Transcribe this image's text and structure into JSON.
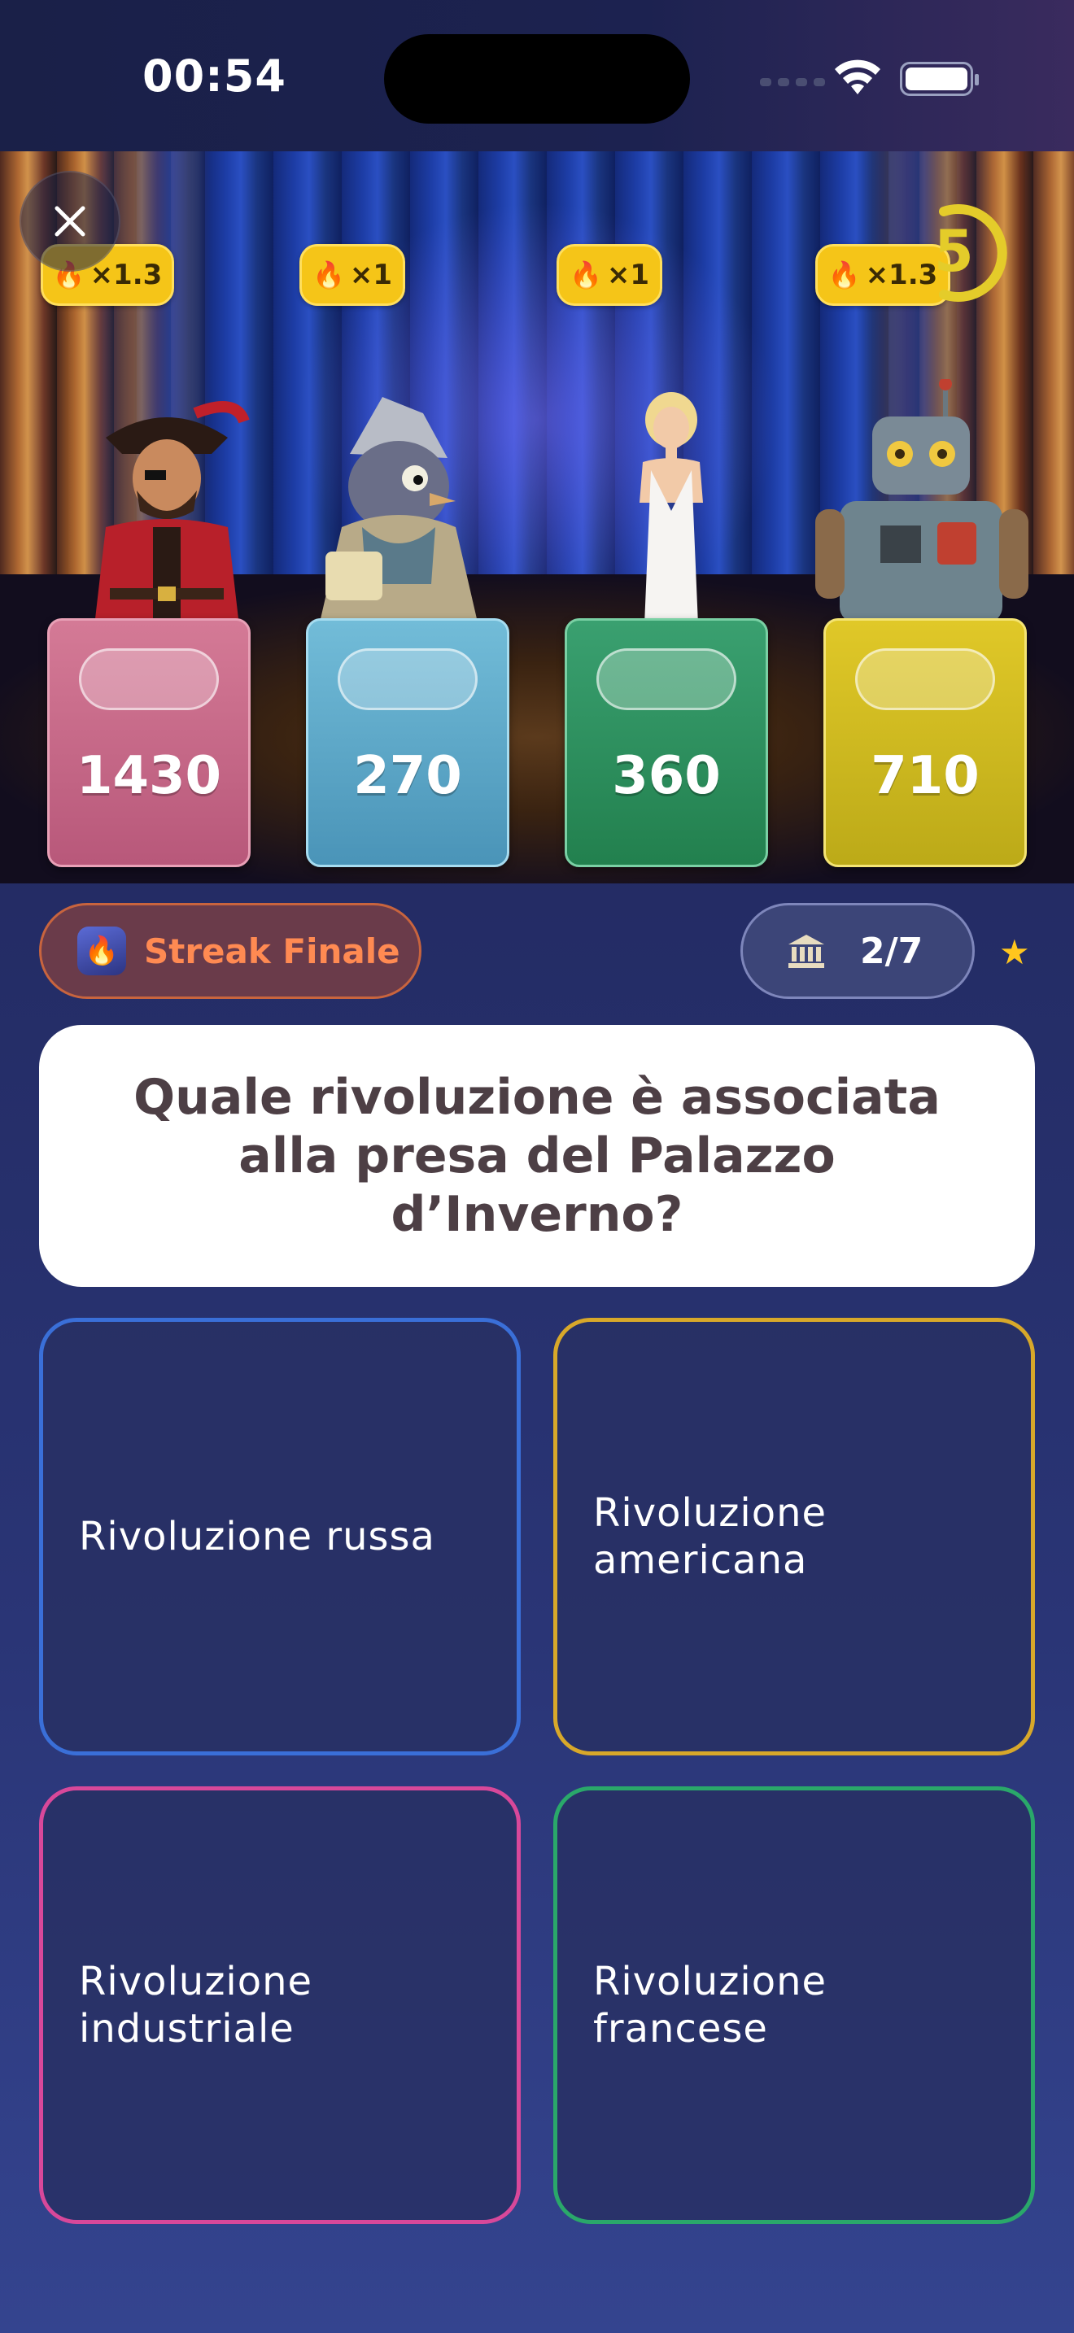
{
  "status_bar": {
    "time": "00:54"
  },
  "game": {
    "timer_value": "5",
    "timer_fraction_remaining": 0.75,
    "multipliers": [
      "×1.3",
      "×1",
      "×1",
      "×1.3"
    ],
    "players": [
      {
        "character": "pirate",
        "score": "1430",
        "color": "#c8607e"
      },
      {
        "character": "pigeon",
        "score": "270",
        "color": "#5aa8c8"
      },
      {
        "character": "diva",
        "score": "360",
        "color": "#2f8f5c"
      },
      {
        "character": "robot",
        "score": "710",
        "color": "#d8c022"
      }
    ]
  },
  "streak": {
    "label": "Streak Finale"
  },
  "progress": {
    "value": "2/7",
    "category_icon": "temple-icon"
  },
  "question": {
    "text": "Quale rivoluzione è associata alla presa del Palazzo d’Inverno?"
  },
  "answers": [
    {
      "label": "Rivoluzione russa",
      "color": "#3a6fd8"
    },
    {
      "label": "Rivoluzione americana",
      "color": "#d8a82a"
    },
    {
      "label": "Rivoluzione industriale",
      "color": "#d8489a"
    },
    {
      "label": "Rivoluzione francese",
      "color": "#2aa86a"
    }
  ],
  "colors": {
    "accent_yellow": "#f5c518",
    "streak_orange": "#ff8a52"
  }
}
